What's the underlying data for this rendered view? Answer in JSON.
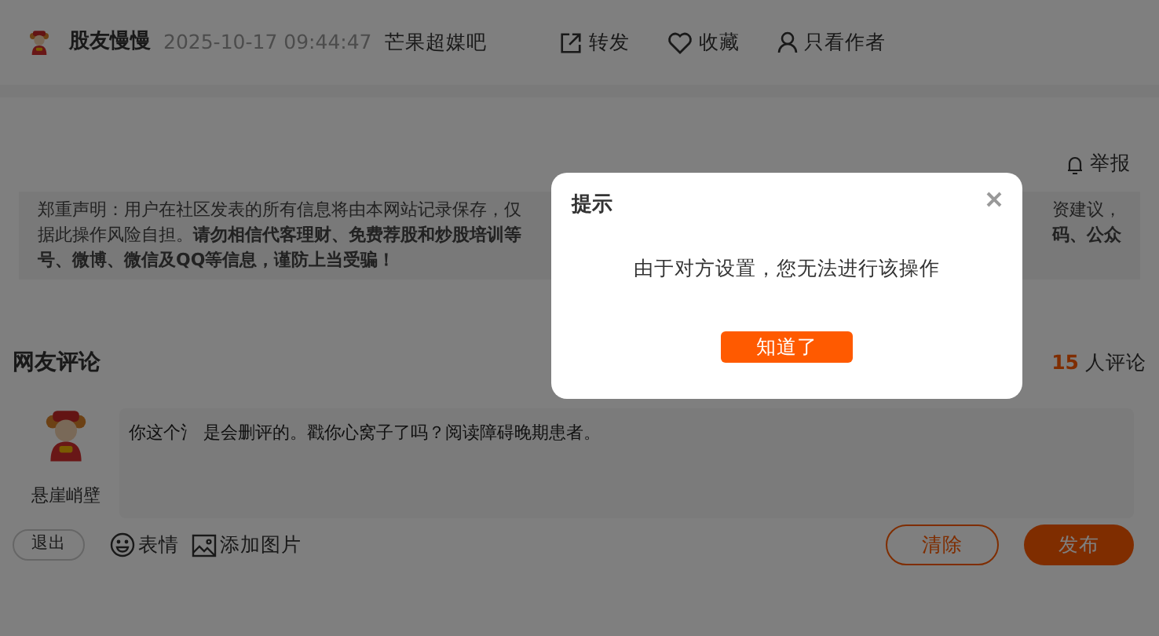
{
  "post": {
    "author": "股友慢慢",
    "time": "2025-10-17 09:44:47",
    "forum": "芒果超媒吧",
    "actions": [
      {
        "kind": "share",
        "label": "转发"
      },
      {
        "kind": "favorite",
        "label": "收藏"
      },
      {
        "kind": "author",
        "label": "只看作者"
      }
    ],
    "report": "举报"
  },
  "disclaimer": [
    {
      "left": "郑重声明：用户在社区发表的所有信息将由本网站记录保存，仅",
      "right": "资建议，"
    },
    {
      "left": "据此操作风险自担。**请勿相信代客理财、免费荐股和炒股培训等**",
      "right": "**码、公众**"
    },
    {
      "left": "**号、微博、微信及QQ等信息，谨防上当受骗！**"
    }
  ],
  "comments": {
    "title": "网友评论",
    "count": "15",
    "count_label": "人评论",
    "user": "悬崖峭壁",
    "logout": "退出",
    "input_value": "你这个氵 是会删评的。戳你心窝子了吗？阅读障碍晚期患者。",
    "tools": [
      {
        "kind": "emoji",
        "label": "表情"
      },
      {
        "kind": "image",
        "label": "添加图片"
      }
    ],
    "clear": "清除",
    "publish": "发布"
  },
  "dialog": {
    "title": "提示",
    "message": "由于对方设置，您无法进行该操作",
    "confirm": "知道了"
  }
}
